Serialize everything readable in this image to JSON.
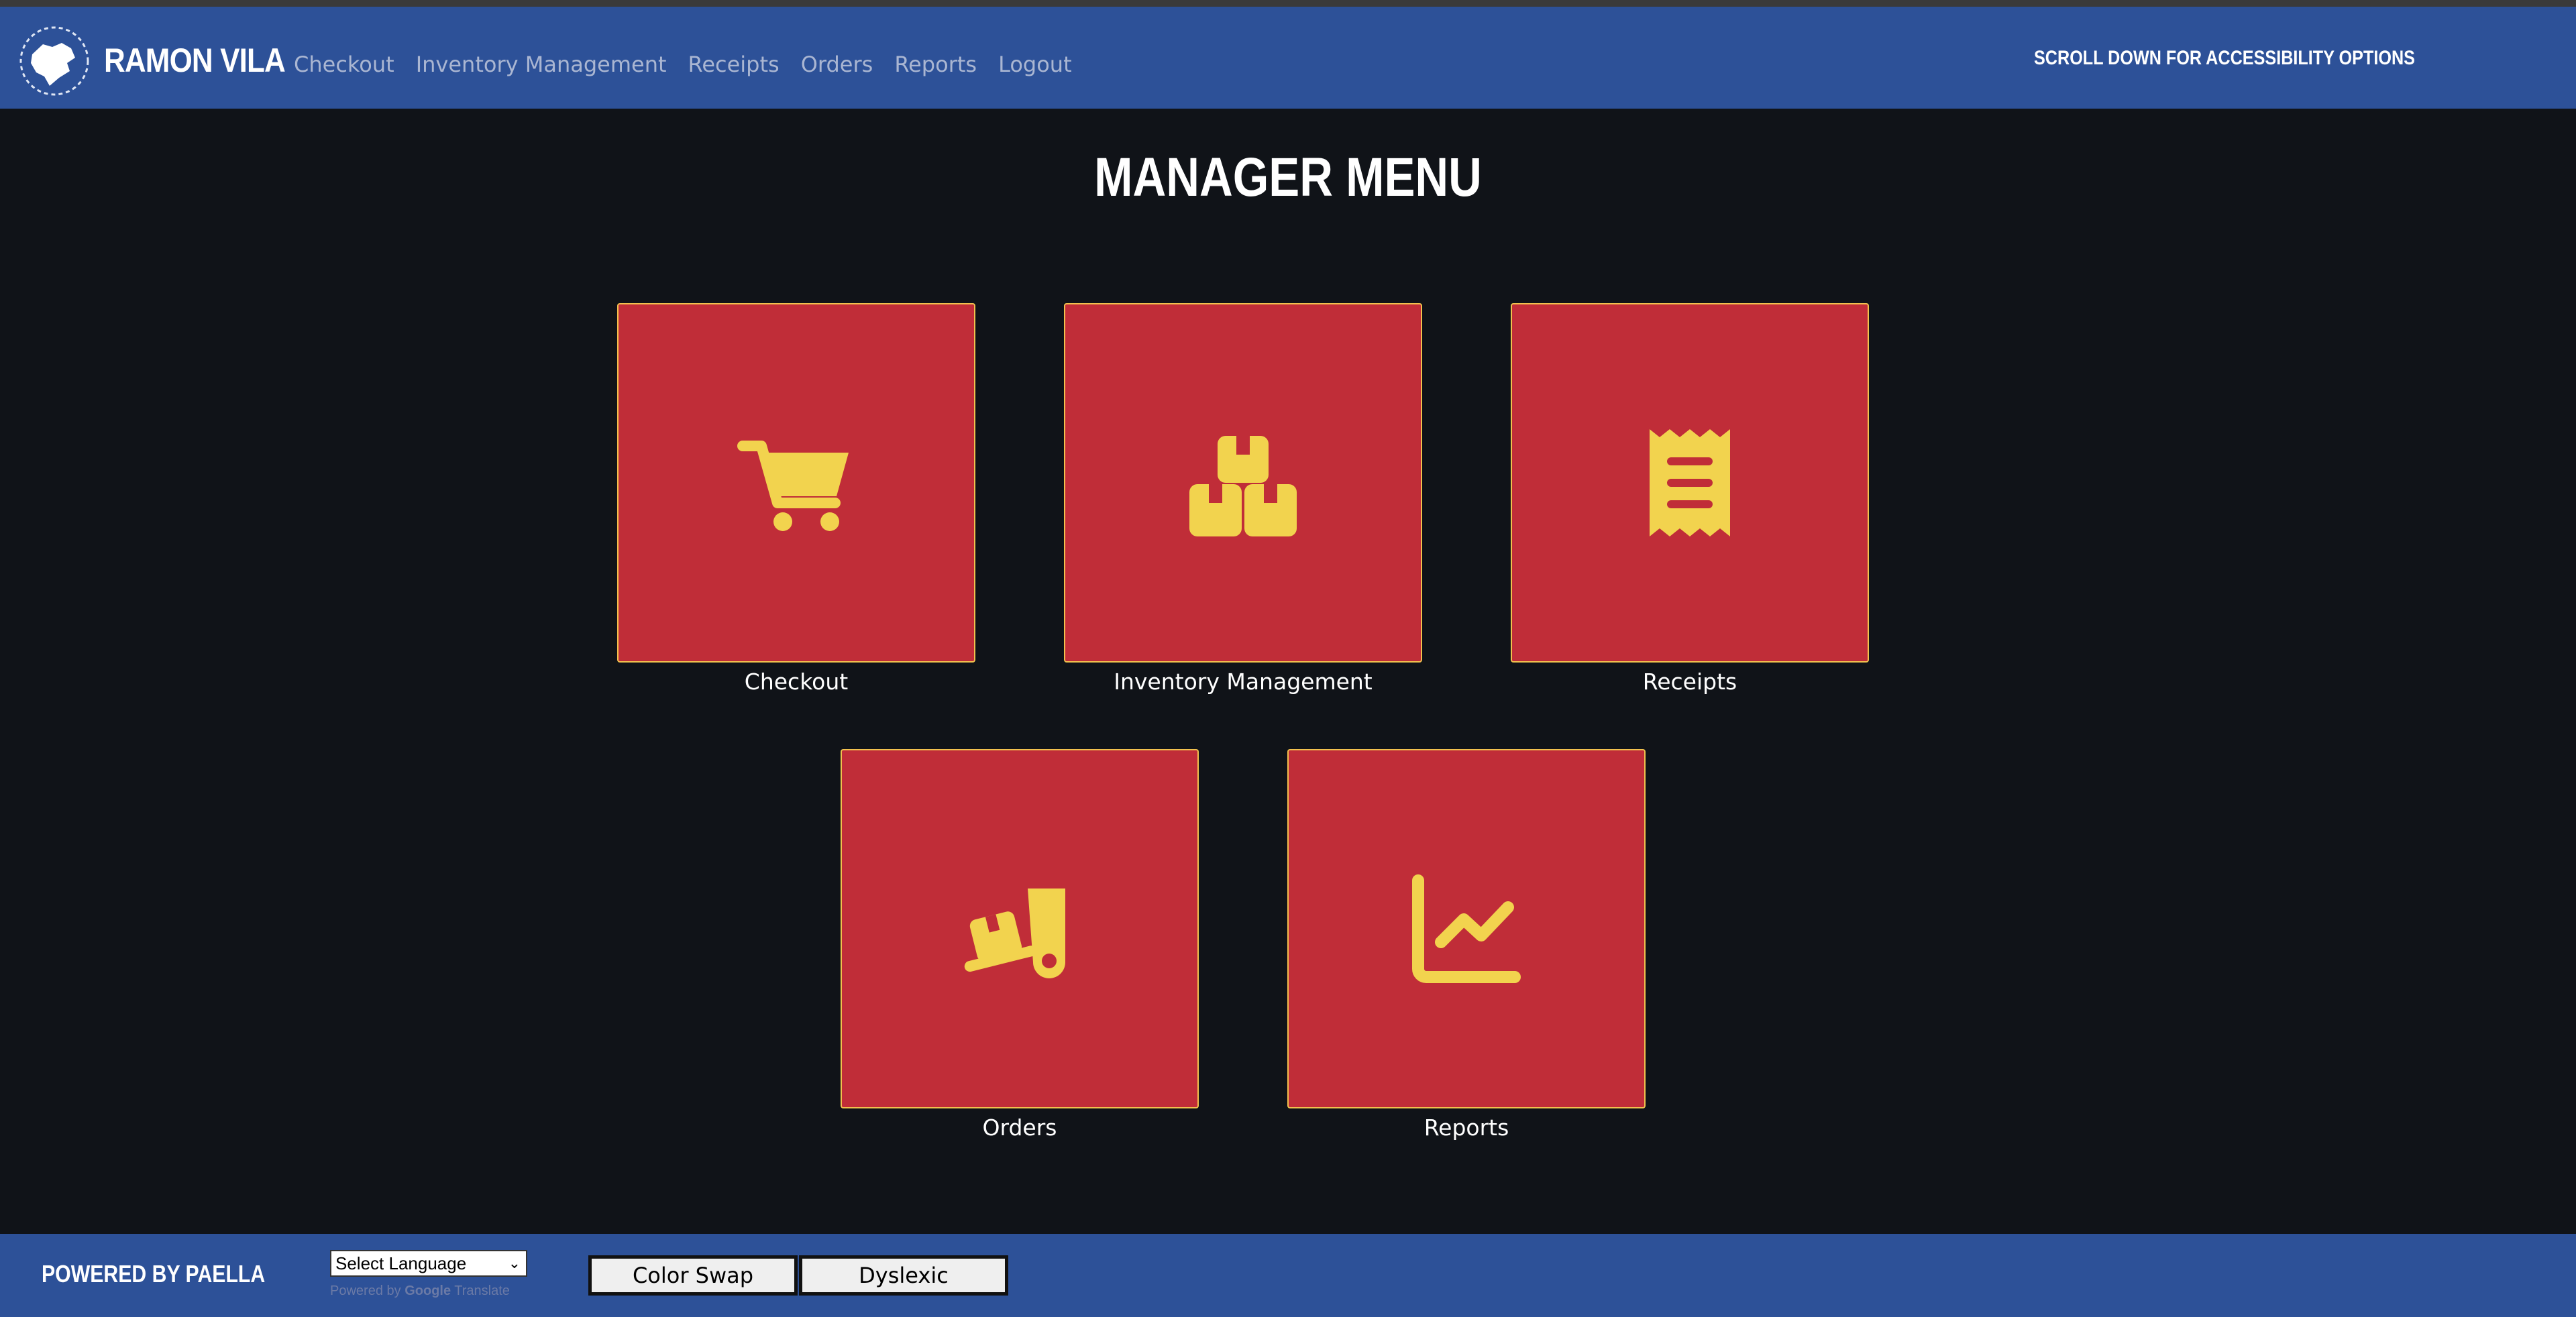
{
  "header": {
    "brand": "RAMON VILA",
    "nav": [
      "Checkout",
      "Inventory Management",
      "Receipts",
      "Orders",
      "Reports",
      "Logout"
    ],
    "accessibility_note": "SCROLL DOWN FOR ACCESSIBILITY OPTIONS",
    "logo_icon": "paella-logo-icon"
  },
  "main": {
    "title": "MANAGER MENU",
    "tiles": [
      {
        "label": "Checkout",
        "icon": "cart-icon"
      },
      {
        "label": "Inventory Management",
        "icon": "boxes-icon"
      },
      {
        "label": "Receipts",
        "icon": "receipt-icon"
      },
      {
        "label": "Orders",
        "icon": "dolly-icon"
      },
      {
        "label": "Reports",
        "icon": "chart-line-icon"
      }
    ]
  },
  "footer": {
    "powered_by": "POWERED BY PAELLA",
    "language_select": "Select Language",
    "translate_prefix": "Powered by",
    "translate_google": "Google",
    "translate_suffix": "Translate",
    "buttons": [
      "Color Swap",
      "Dyslexic"
    ]
  },
  "colors": {
    "nav_bg": "#2d5198",
    "page_bg": "#101318",
    "tile_bg": "#c02d38",
    "tile_border": "#f2c14e",
    "icon": "#f2d34e"
  }
}
